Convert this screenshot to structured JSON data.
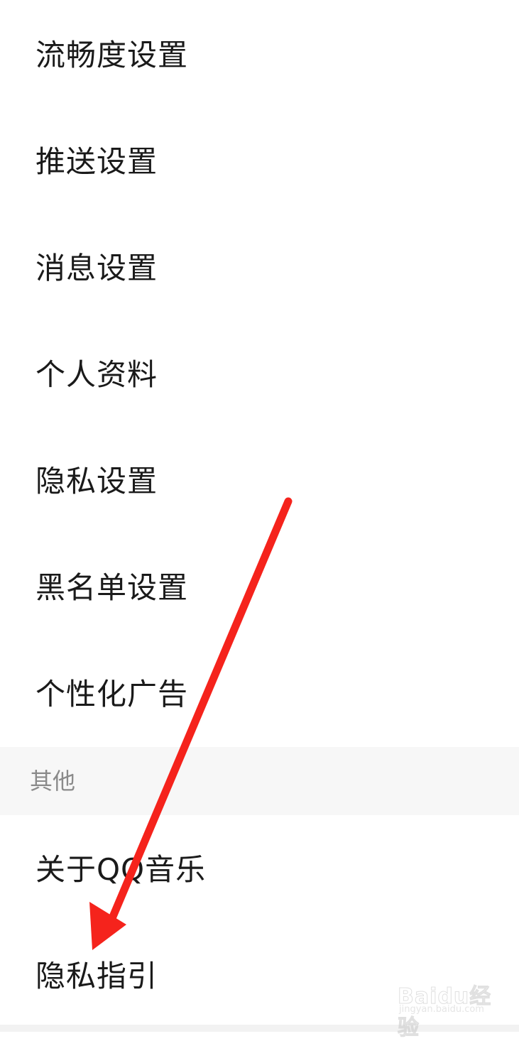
{
  "settings": {
    "items": [
      {
        "label": "流畅度设置"
      },
      {
        "label": "推送设置"
      },
      {
        "label": "消息设置"
      },
      {
        "label": "个人资料"
      },
      {
        "label": "隐私设置"
      },
      {
        "label": "黑名单设置"
      },
      {
        "label": "个性化广告"
      }
    ]
  },
  "other_section": {
    "header": "其他",
    "items": [
      {
        "label": "关于QQ音乐"
      },
      {
        "label": "隐私指引"
      }
    ]
  },
  "watermark": {
    "brand": "Baidu经验",
    "url": "jingyan.baidu.com"
  },
  "colors": {
    "text": "#1a1a1a",
    "section_text": "#8a8a8a",
    "section_bg": "#f7f7f7",
    "arrow": "#f5231c"
  }
}
